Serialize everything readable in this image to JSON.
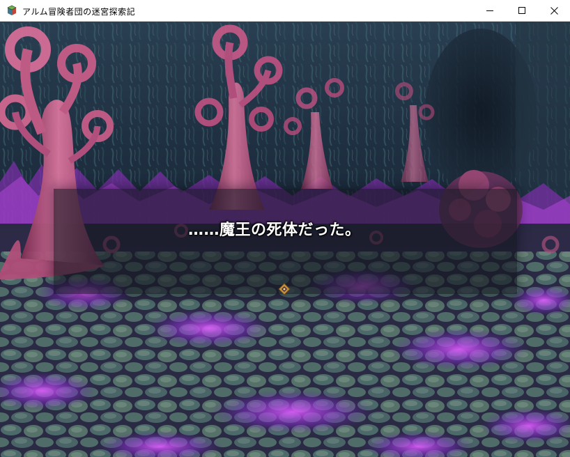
{
  "window": {
    "title": "アルム冒険者団の迷宮探索記",
    "app_icon": "game-cube-icon",
    "controls": {
      "minimize_icon": "minimize-icon",
      "maximize_icon": "maximize-icon",
      "close_icon": "close-icon"
    }
  },
  "game": {
    "scene": "purple-fungal-cave",
    "message": {
      "text": "……魔王の死体だった。",
      "pause_indicator_icon": "pause-diamond-icon"
    }
  },
  "colors": {
    "title_bar": "#ffffff",
    "message_window": "#141620",
    "glow": "#b04dff",
    "trees": "#c85a86"
  }
}
